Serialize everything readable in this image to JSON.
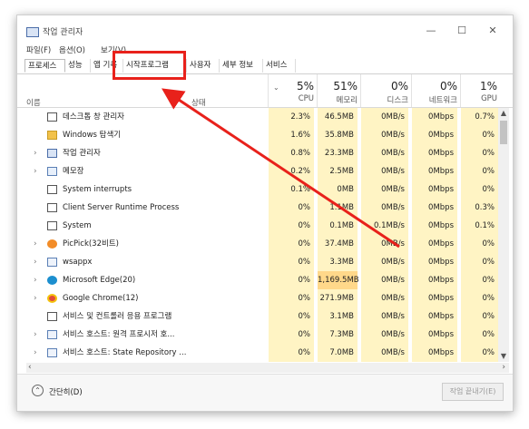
{
  "window": {
    "title": "작업 관리자",
    "minimize": "—",
    "maximize": "☐",
    "close": "✕"
  },
  "menu": [
    "파일(F)",
    "옵션(O)",
    "보기(V)"
  ],
  "tabs": [
    "프로세스",
    "성능",
    "앱 기록",
    "시작프로그램",
    "사용자",
    "세부 정보",
    "서비스"
  ],
  "columns": {
    "name": "이름",
    "status": "상태",
    "cpu": {
      "pct": "5%",
      "label": "CPU"
    },
    "memory": {
      "pct": "51%",
      "label": "메모리"
    },
    "disk": {
      "pct": "0%",
      "label": "디스크"
    },
    "network": {
      "pct": "0%",
      "label": "네트워크"
    },
    "gpu": {
      "pct": "1%",
      "label": "GPU"
    }
  },
  "processes": [
    {
      "name": "데스크톱 창 관리자",
      "expand": false,
      "icon": "window-icon",
      "cpu": "2.3%",
      "mem": "46.5MB",
      "disk": "0MB/s",
      "net": "0Mbps",
      "gpu": "0.7%"
    },
    {
      "name": "Windows 탐색기",
      "expand": false,
      "icon": "folder-icon",
      "cpu": "1.6%",
      "mem": "35.8MB",
      "disk": "0MB/s",
      "net": "0Mbps",
      "gpu": "0%"
    },
    {
      "name": "작업 관리자",
      "expand": true,
      "icon": "taskmgr-icon",
      "cpu": "0.8%",
      "mem": "23.3MB",
      "disk": "0MB/s",
      "net": "0Mbps",
      "gpu": "0%"
    },
    {
      "name": "메모장",
      "expand": true,
      "icon": "notepad-icon",
      "cpu": "0.2%",
      "mem": "2.5MB",
      "disk": "0MB/s",
      "net": "0Mbps",
      "gpu": "0%"
    },
    {
      "name": "System interrupts",
      "expand": false,
      "icon": "window-icon",
      "cpu": "0.1%",
      "mem": "0MB",
      "disk": "0MB/s",
      "net": "0Mbps",
      "gpu": "0%"
    },
    {
      "name": "Client Server Runtime Process",
      "expand": false,
      "icon": "window-icon",
      "cpu": "0%",
      "mem": "1.1MB",
      "disk": "0MB/s",
      "net": "0Mbps",
      "gpu": "0.3%"
    },
    {
      "name": "System",
      "expand": false,
      "icon": "window-icon",
      "cpu": "0%",
      "mem": "0.1MB",
      "disk": "0.1MB/s",
      "net": "0Mbps",
      "gpu": "0.1%"
    },
    {
      "name": "PicPick(32비트)",
      "expand": true,
      "icon": "picpick-icon",
      "cpu": "0%",
      "mem": "37.4MB",
      "disk": "0MB/s",
      "net": "0Mbps",
      "gpu": "0%"
    },
    {
      "name": "wsappx",
      "expand": true,
      "icon": "gear-icon",
      "cpu": "0%",
      "mem": "3.3MB",
      "disk": "0MB/s",
      "net": "0Mbps",
      "gpu": "0%"
    },
    {
      "name": "Microsoft Edge(20)",
      "expand": true,
      "icon": "edge-icon",
      "cpu": "0%",
      "mem": "1,169.5MB",
      "disk": "0MB/s",
      "net": "0Mbps",
      "gpu": "0%"
    },
    {
      "name": "Google Chrome(12)",
      "expand": true,
      "icon": "chrome-icon",
      "cpu": "0%",
      "mem": "271.9MB",
      "disk": "0MB/s",
      "net": "0Mbps",
      "gpu": "0%"
    },
    {
      "name": "서비스 및 컨트롤러 응용 프로그램",
      "expand": false,
      "icon": "window-icon",
      "cpu": "0%",
      "mem": "3.1MB",
      "disk": "0MB/s",
      "net": "0Mbps",
      "gpu": "0%"
    },
    {
      "name": "서비스 호스트: 원격 프로시저 호...",
      "expand": true,
      "icon": "gear-icon",
      "cpu": "0%",
      "mem": "7.3MB",
      "disk": "0MB/s",
      "net": "0Mbps",
      "gpu": "0%"
    },
    {
      "name": "서비스 호스트: State Repository ...",
      "expand": true,
      "icon": "gear-icon",
      "cpu": "0%",
      "mem": "7.0MB",
      "disk": "0MB/s",
      "net": "0Mbps",
      "gpu": "0%"
    }
  ],
  "footer": {
    "collapse": "간단히(D)",
    "end_task": "작업 끝내기(E)"
  },
  "colors": {
    "highlight_yellow": "#fff4c4",
    "highlight_orange": "#ffd88a",
    "annotation_red": "#e8211b"
  }
}
